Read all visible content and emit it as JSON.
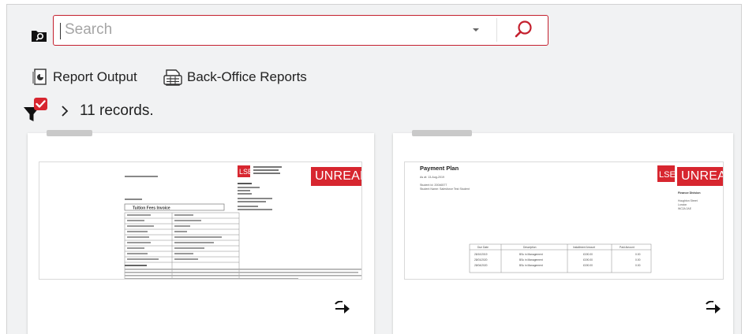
{
  "search": {
    "placeholder": "Search",
    "value": ""
  },
  "links": {
    "report_output": "Report Output",
    "back_office_reports": "Back-Office Reports"
  },
  "filter": {
    "records_text": "11 records."
  },
  "cards": [
    {
      "badge": "UNREAD",
      "logo_text": "LSE",
      "doc_title": "Tuition Fees Invoice"
    },
    {
      "badge": "UNREAD",
      "logo_text": "LSE",
      "doc_title": "Payment Plan",
      "doc_date": "As at: 13-Aug-2019",
      "student_id": "Student Id: 20046577",
      "student_name": "Student Name: Salesforce Test Student",
      "finance": "Finance Division",
      "address": [
        "Houghton Street",
        "London",
        "WC2A 2AE"
      ],
      "table_headers": [
        "Due Date",
        "Description",
        "Installment Amount",
        "Paid Amount"
      ],
      "table_rows": [
        [
          "28/10/2019",
          "BSc in Management",
          "£190.00",
          "0.00"
        ],
        [
          "28/01/2020",
          "BSc in Management",
          "£190.00",
          "0.00"
        ],
        [
          "28/04/2020",
          "BSc in Management",
          "£190.00",
          "0.00"
        ]
      ]
    }
  ],
  "colors": {
    "accent": "#c4202e",
    "badge": "#d7262f",
    "panel": "#f1f2f3"
  },
  "icons": [
    "folder-search-icon",
    "chevron-down-icon",
    "search-icon",
    "report-output-icon",
    "back-office-reports-icon",
    "filter-check-icon",
    "chevron-right-icon",
    "action-arrow-icon"
  ]
}
